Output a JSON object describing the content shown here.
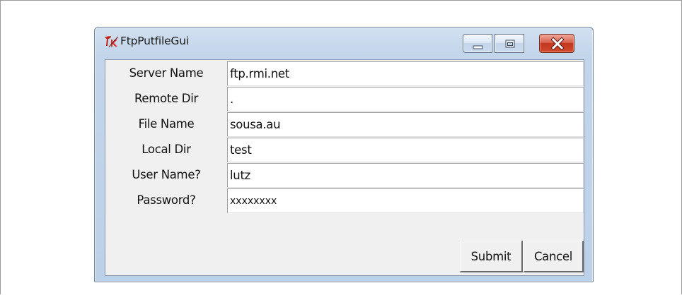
{
  "window": {
    "title": "FtpPutfileGui",
    "controls": {
      "minimize_icon": "minimize-icon",
      "maximize_icon": "maximize-icon",
      "close_icon": "close-icon"
    }
  },
  "form": {
    "rows": [
      {
        "label": "Server Name",
        "value": "ftp.rmi.net"
      },
      {
        "label": "Remote Dir",
        "value": "."
      },
      {
        "label": "File Name",
        "value": "sousa.au"
      },
      {
        "label": "Local Dir",
        "value": "test"
      },
      {
        "label": "User Name?",
        "value": "lutz"
      },
      {
        "label": "Password?",
        "value": "xxxxxxxx"
      }
    ]
  },
  "buttons": {
    "submit_label": "Submit",
    "cancel_label": "Cancel"
  },
  "colors": {
    "close_button": "#c1371f",
    "client_background": "#f0f0f0",
    "titlebar": "#c2d5ea"
  }
}
